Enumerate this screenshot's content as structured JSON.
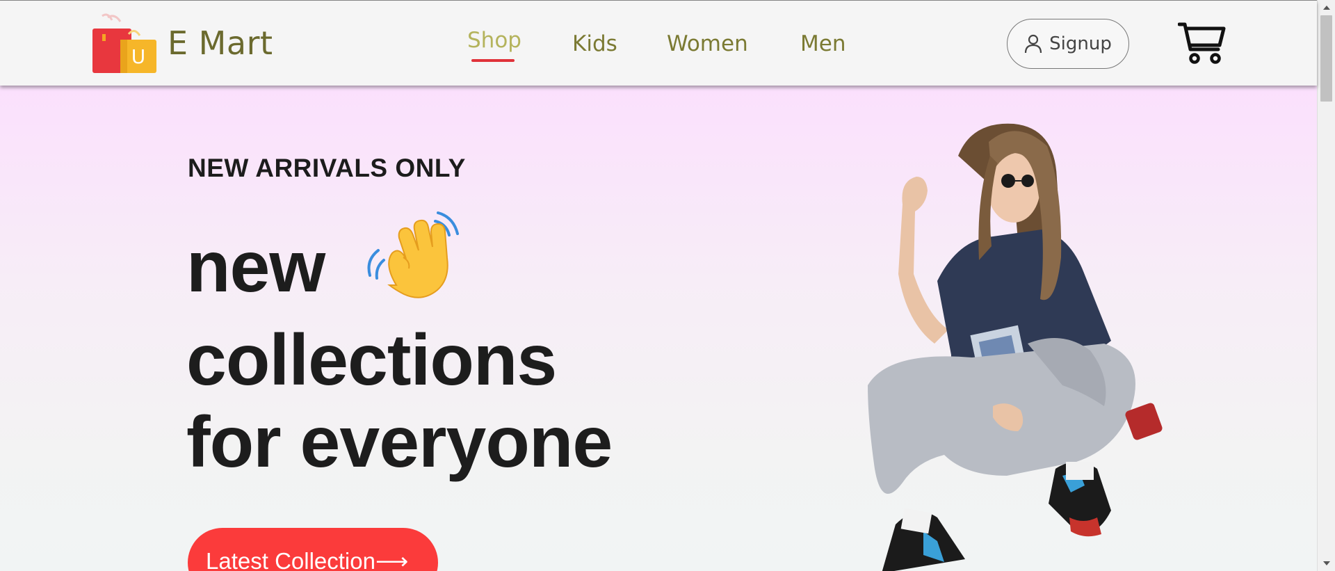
{
  "brand": {
    "name": "E Mart",
    "logo_letter": "U"
  },
  "nav": {
    "items": [
      {
        "label": "Shop",
        "active": true
      },
      {
        "label": "Kids",
        "active": false
      },
      {
        "label": "Women",
        "active": false
      },
      {
        "label": "Men",
        "active": false
      }
    ]
  },
  "header": {
    "signup_label": "Signup"
  },
  "hero": {
    "kicker": "NEW ARRIVALS ONLY",
    "headline_line1": "new",
    "headline_line2": "collections",
    "headline_line3": "for everyone",
    "cta_label": "Latest Collection",
    "cta_arrow": "⟶",
    "wave_emoji": "waving-hand-icon",
    "hero_image": "fashion-model-image"
  },
  "colors": {
    "nav_text": "#7b7a33",
    "nav_active": "#b4b35c",
    "underline": "#e0323a",
    "cta": "#fb3b3b",
    "hero_top": "#fbe0fd",
    "hero_bottom": "#f1f4f4"
  }
}
